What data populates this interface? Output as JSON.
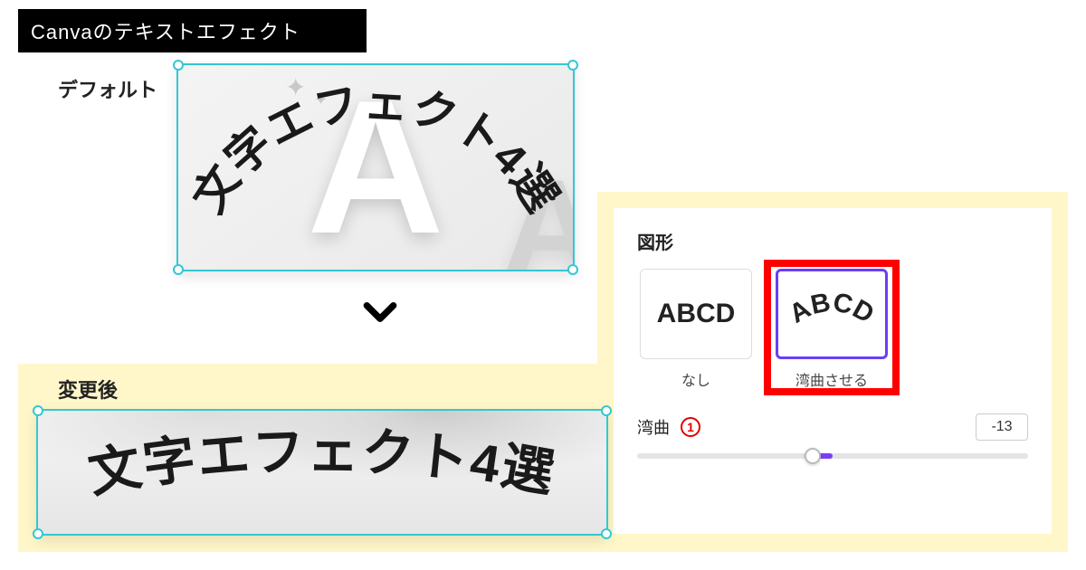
{
  "header": {
    "title": "Canvaのテキストエフェクト"
  },
  "labels": {
    "default": "デフォルト",
    "after": "変更後"
  },
  "sample_text": "文字エフェクト4選",
  "panel": {
    "title": "図形",
    "options": [
      {
        "label": "なし",
        "sample": "ABCD"
      },
      {
        "label": "湾曲させる",
        "sample": "ABCD"
      }
    ],
    "slider": {
      "label": "湾曲",
      "marker": "1",
      "value": "-13"
    }
  }
}
